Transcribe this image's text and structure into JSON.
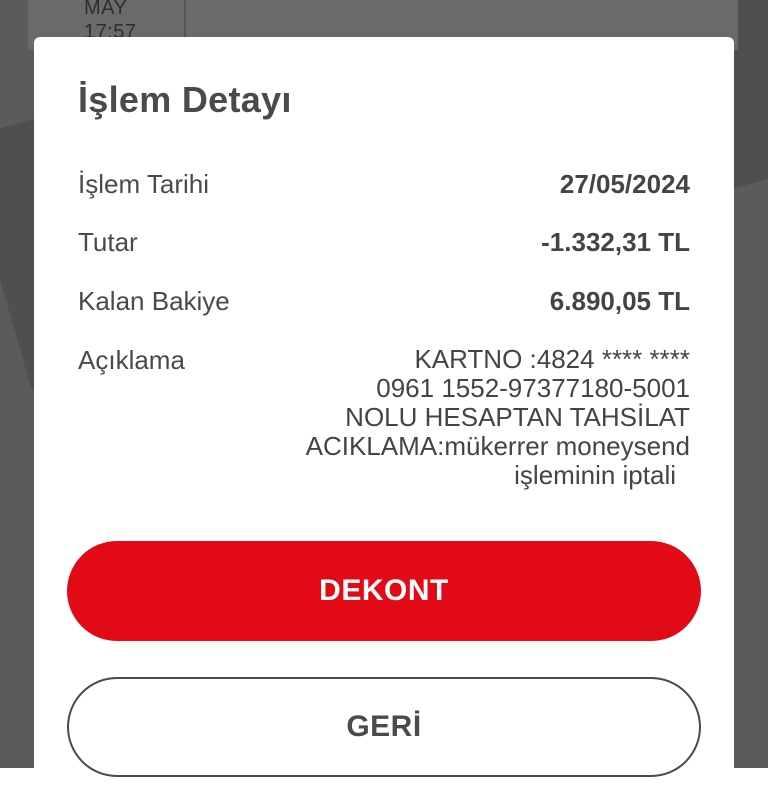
{
  "background": {
    "month": "MAY",
    "time": "17:57"
  },
  "dialog": {
    "title": "İşlem Detayı",
    "rows": [
      {
        "label": "İşlem Tarihi",
        "value": "27/05/2024"
      },
      {
        "label": "Tutar",
        "value": "-1.332,31 TL"
      },
      {
        "label": "Kalan Bakiye",
        "value": "6.890,05 TL"
      }
    ],
    "description": {
      "label": "Açıklama",
      "lines": [
        "KARTNO :4824 **** ****",
        "0961 1552-97377180-5001",
        "NOLU HESAPTAN TAHSİLAT",
        "ACIKLAMA:mükerrer moneysend",
        "işleminin iptali"
      ]
    },
    "buttons": {
      "primary": "DEKONT",
      "secondary": "GERİ"
    }
  },
  "colors": {
    "accent": "#e30a17",
    "text": "#4a4a4a",
    "overlay": "#5b5b5b"
  }
}
